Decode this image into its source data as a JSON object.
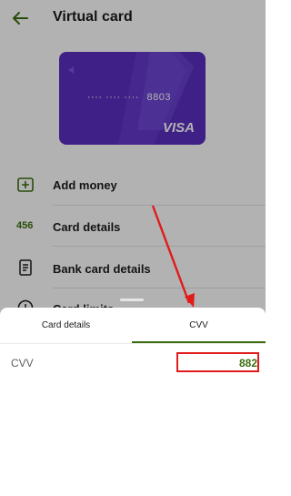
{
  "header": {
    "title": "Virtual card",
    "back_icon": "arrow-left-icon"
  },
  "card": {
    "masked_number": "···· ···· ····",
    "last4": "8803",
    "brand": "VISA",
    "color": "#5a2fc2"
  },
  "menu": {
    "items": [
      {
        "label": "Add money",
        "icon": "plus-square-icon"
      },
      {
        "label": "Card details",
        "icon_text": "456"
      },
      {
        "label": "Bank card details",
        "icon": "document-icon"
      },
      {
        "label": "Card limits",
        "icon": "clock-icon"
      }
    ]
  },
  "sheet": {
    "tabs": [
      {
        "label": "Card details"
      },
      {
        "label": "CVV"
      }
    ],
    "active_tab": "CVV",
    "cvv": {
      "label": "CVV",
      "value": "882"
    }
  },
  "colors": {
    "accent": "#3c6e0f",
    "annotation": "#e11b1b"
  }
}
